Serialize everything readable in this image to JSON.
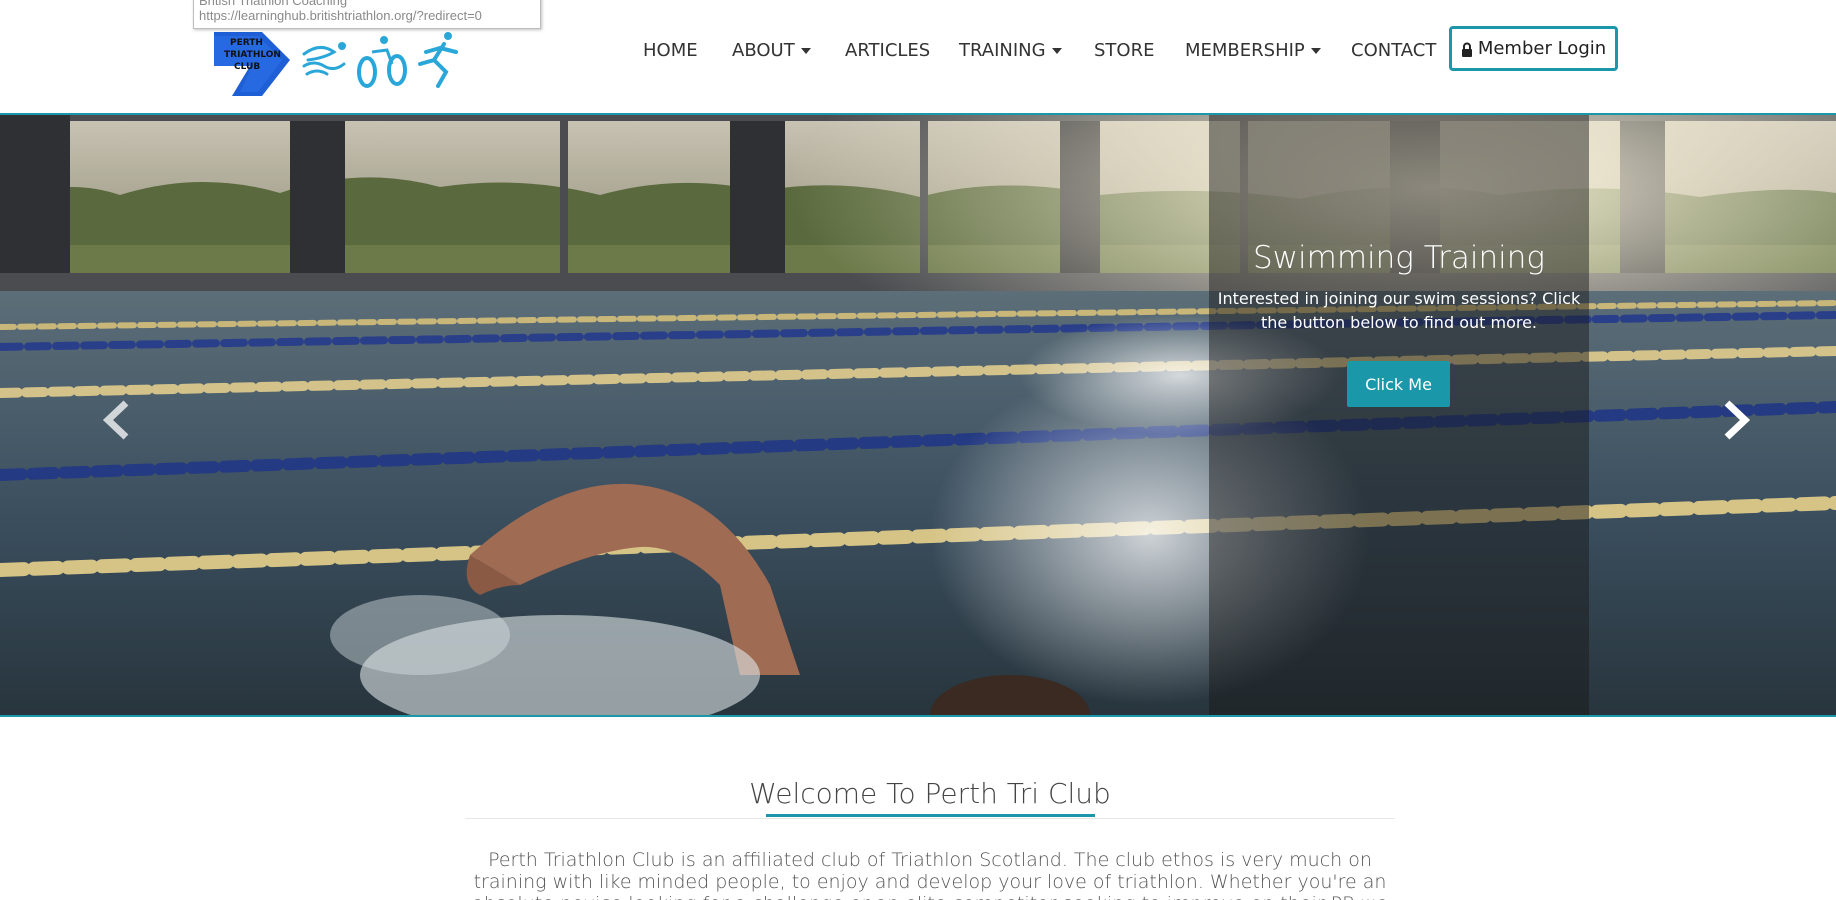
{
  "tooltip": {
    "title": "British Triathlon Coaching",
    "url": "https://learninghub.britishtriathlon.org/?redirect=0"
  },
  "logo": {
    "line1": "PERTH",
    "line2": "TRIATHLON",
    "line3": "CLUB"
  },
  "nav": {
    "items": [
      {
        "label": "HOME",
        "dropdown": false
      },
      {
        "label": "ABOUT",
        "dropdown": true
      },
      {
        "label": "ARTICLES",
        "dropdown": false
      },
      {
        "label": "TRAINING",
        "dropdown": true
      },
      {
        "label": "STORE",
        "dropdown": false
      },
      {
        "label": "MEMBERSHIP",
        "dropdown": true
      },
      {
        "label": "CONTACT",
        "dropdown": false
      }
    ],
    "login_label": "Member Login"
  },
  "hero": {
    "title": "Swimming Training",
    "text": "Interested in joining our swim sessions? Click the button below to find out more.",
    "button": "Click Me"
  },
  "welcome": {
    "title": "Welcome To Perth Tri Club",
    "body": "Perth Triathlon Club is an affiliated club of Triathlon Scotland. The club ethos is very much on training with like minded people, to enjoy and develop your love of triathlon.  Whether you're an absolute novice looking for a challenge or an elite competitor seeking to improve on their PB we welcome all abilities."
  },
  "colors": {
    "accent": "#1a98a9",
    "logo_blue": "#1f5fd6",
    "logo_cyan": "#2aa7d8"
  }
}
